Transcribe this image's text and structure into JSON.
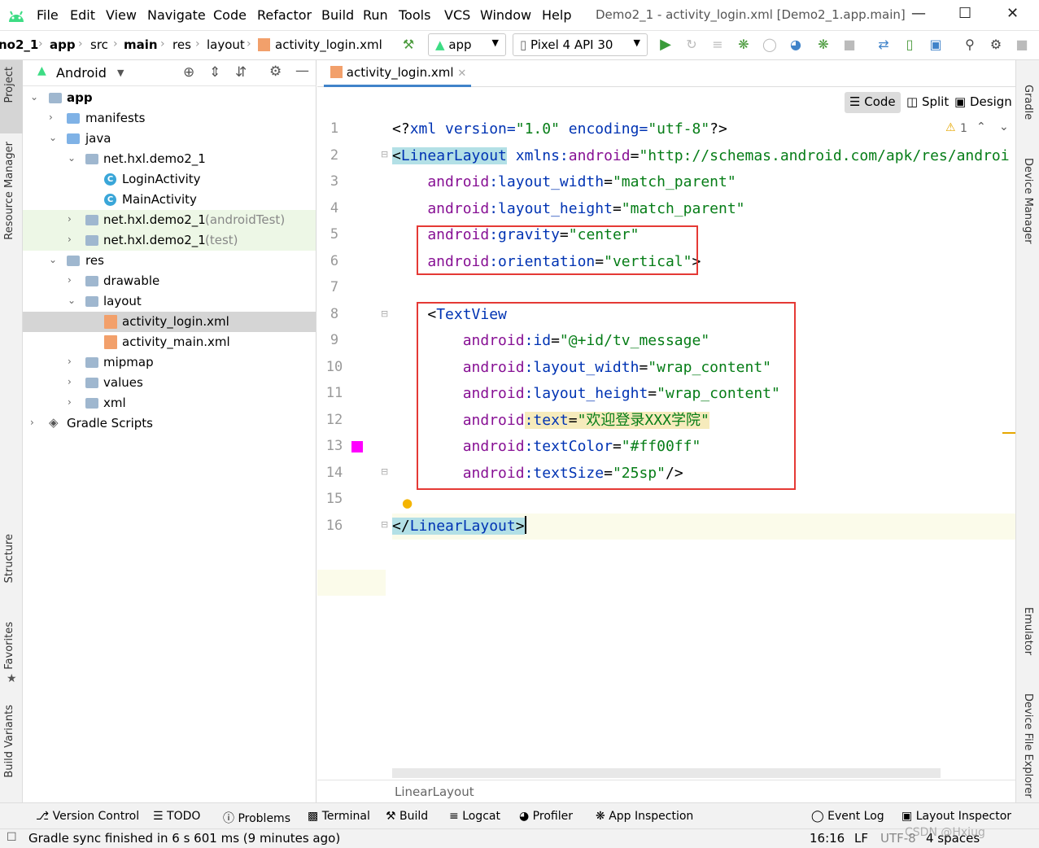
{
  "menubar": {
    "items": [
      "File",
      "Edit",
      "View",
      "Navigate",
      "Code",
      "Refactor",
      "Build",
      "Run",
      "Tools",
      "VCS",
      "Window",
      "Help"
    ],
    "window_title": "Demo2_1 - activity_login.xml [Demo2_1.app.main]"
  },
  "navbar": {
    "breadcrumbs": [
      "no2_1",
      "app",
      "src",
      "main",
      "res",
      "layout",
      "activity_login.xml"
    ],
    "run_config": "app",
    "device": "Pixel 4 API 30"
  },
  "left_strip": {
    "tabs": [
      "Project",
      "Resource Manager",
      "Structure",
      "Favorites",
      "Build Variants"
    ]
  },
  "right_strip": {
    "tabs": [
      "Gradle",
      "Device Manager",
      "Emulator",
      "Device File Explorer"
    ]
  },
  "project": {
    "view_mode": "Android",
    "tree": [
      {
        "label": "app"
      },
      {
        "label": "manifests"
      },
      {
        "label": "java"
      },
      {
        "label": "net.hxl.demo2_1"
      },
      {
        "label": "LoginActivity"
      },
      {
        "label": "MainActivity"
      },
      {
        "label": "net.hxl.demo2_1",
        "suffix": "(androidTest)"
      },
      {
        "label": "net.hxl.demo2_1",
        "suffix": "(test)"
      },
      {
        "label": "res"
      },
      {
        "label": "drawable"
      },
      {
        "label": "layout"
      },
      {
        "label": "activity_login.xml"
      },
      {
        "label": "activity_main.xml"
      },
      {
        "label": "mipmap"
      },
      {
        "label": "values"
      },
      {
        "label": "xml"
      },
      {
        "label": "Gradle Scripts"
      }
    ]
  },
  "editor": {
    "tab": "activity_login.xml",
    "view_buttons": [
      "Code",
      "Split",
      "Design"
    ],
    "warning_count": "1",
    "line_numbers": [
      "1",
      "2",
      "3",
      "4",
      "5",
      "6",
      "7",
      "8",
      "9",
      "10",
      "11",
      "12",
      "13",
      "14",
      "15",
      "16"
    ],
    "lines": {
      "l1": {
        "a": "<?",
        "b": "xml",
        "c": " version=",
        "d": "\"1.0\"",
        "e": " encoding=",
        "f": "\"utf-8\"",
        "g": "?>"
      },
      "l2": {
        "a": "<",
        "b": "LinearLayout",
        "c": " xmlns:",
        "d": "android",
        "e": "=",
        "f": "\"http://schemas.android.com/apk/res/androi"
      },
      "l3": {
        "a": "    android",
        "b": ":layout_width",
        "c": "=",
        "d": "\"match_parent\""
      },
      "l4": {
        "a": "    android",
        "b": ":layout_height",
        "c": "=",
        "d": "\"match_parent\""
      },
      "l5": {
        "a": "    android",
        "b": ":gravity",
        "c": "=",
        "d": "\"center\""
      },
      "l6": {
        "a": "    android",
        "b": ":orientation",
        "c": "=",
        "d": "\"vertical\"",
        "e": ">"
      },
      "l8": {
        "a": "    <",
        "b": "TextView"
      },
      "l9": {
        "a": "        android",
        "b": ":id",
        "c": "=",
        "d": "\"@+id/tv_message\""
      },
      "l10": {
        "a": "        android",
        "b": ":layout_width",
        "c": "=",
        "d": "\"wrap_content\""
      },
      "l11": {
        "a": "        android",
        "b": ":layout_height",
        "c": "=",
        "d": "\"wrap_content\""
      },
      "l12": {
        "a": "        android",
        "b": ":text",
        "c": "=",
        "d": "\"欢迎登录XXX学院\""
      },
      "l13": {
        "a": "        android",
        "b": ":textColor",
        "c": "=",
        "d": "\"#ff00ff\""
      },
      "l14": {
        "a": "        android",
        "b": ":textSize",
        "c": "=",
        "d": "\"25sp\"",
        "e": "/>"
      },
      "l16": {
        "a": "</",
        "b": "LinearLayout",
        "c": ">"
      }
    },
    "breadcrumb_footer": "LinearLayout",
    "color_swatch": "#ff00ff"
  },
  "tool_windows": [
    "Version Control",
    "TODO",
    "Problems",
    "Terminal",
    "Build",
    "Logcat",
    "Profiler",
    "App Inspection",
    "Event Log",
    "Layout Inspector"
  ],
  "status": {
    "message": "Gradle sync finished in 6 s 601 ms (9 minutes ago)",
    "position": "16:16",
    "line_sep": "LF",
    "encoding": "UTF-8",
    "indent": "4 spaces",
    "watermark": "CSDN @Hxiug"
  },
  "colors": {
    "accent": "#4083c9",
    "highlight_box": "#e53935",
    "selected_row": "#d5d5d5",
    "test_row": "#edf7e6"
  }
}
